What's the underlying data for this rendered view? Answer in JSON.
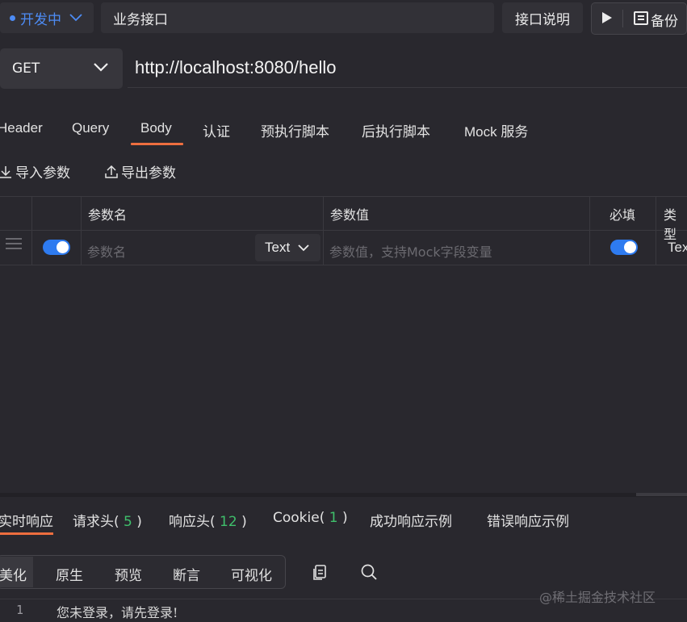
{
  "topbar": {
    "status": "开发中",
    "api_name": "业务接口",
    "doc_button": "接口说明",
    "backup_button": "备份"
  },
  "request": {
    "method": "GET",
    "url": "http://localhost:8080/hello"
  },
  "tabs": [
    {
      "label": "Header"
    },
    {
      "label": "Query"
    },
    {
      "label": "Body",
      "active": true
    },
    {
      "label": "认证"
    },
    {
      "label": "预执行脚本"
    },
    {
      "label": "后执行脚本"
    },
    {
      "label": "Mock 服务"
    }
  ],
  "tools": {
    "import": "导入参数",
    "export": "导出参数"
  },
  "params_table": {
    "headers": [
      "参数名",
      "参数值",
      "必填",
      "类型"
    ],
    "row": {
      "enabled": true,
      "name_placeholder": "参数名",
      "type": "Text",
      "value_placeholder": "参数值，支持Mock字段变量",
      "required": true,
      "param_type": "Text"
    }
  },
  "response": {
    "tabs": [
      {
        "label": "实时响应",
        "active": true
      },
      {
        "label": "请求头",
        "count": "5"
      },
      {
        "label": "响应头",
        "count": "12"
      },
      {
        "label": "Cookie",
        "count": "1"
      },
      {
        "label": "成功响应示例"
      },
      {
        "label": "错误响应示例"
      }
    ],
    "format_buttons": [
      "美化",
      "原生",
      "预览",
      "断言",
      "可视化"
    ],
    "body_lines": [
      {
        "num": "1",
        "text": "您未登录，请先登录!"
      }
    ]
  },
  "watermark": "@稀土掘金技术社区",
  "colors": {
    "accent": "#ee6e3f",
    "primary": "#2e7bf0",
    "count_green": "#3fbf6b",
    "background": "#29282e"
  }
}
